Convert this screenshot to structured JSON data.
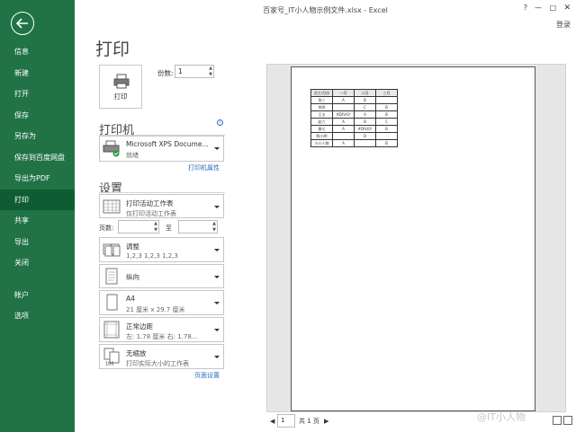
{
  "window": {
    "title": "百家号_IT小人物示例文件.xlsx - Excel",
    "help": "?",
    "min": "—",
    "max": "□",
    "close": "✕",
    "login": "登录"
  },
  "nav": {
    "back_icon": "arrow-left-icon",
    "items": [
      "信息",
      "新建",
      "打开",
      "保存",
      "另存为",
      "保存到百度网盘",
      "导出为PDF",
      "打印",
      "共享",
      "导出",
      "关闭"
    ],
    "items2": [
      "帐户",
      "选项"
    ],
    "active": "打印"
  },
  "page": {
    "title": "打印"
  },
  "print": {
    "button_label": "打印",
    "copies_label": "份数:",
    "copies_value": "1"
  },
  "printer": {
    "header": "打印机",
    "name": "Microsoft XPS Docume...",
    "status": "就绪",
    "properties_link": "打印机属性",
    "info_icon": "i"
  },
  "settings": {
    "header": "设置",
    "scope": {
      "line1": "打印活动工作表",
      "line2": "仅打印活动工作表"
    },
    "pages_label": "页数:",
    "to_label": "至",
    "collate": {
      "line1": "调整",
      "line2": "1,2,3    1,2,3    1,2,3"
    },
    "orientation": {
      "line1": "纵向"
    },
    "paper": {
      "line1": "A4",
      "line2": "21 厘米 x 29.7 厘米"
    },
    "margins": {
      "line1": "正常边距",
      "line2": "左: 1.78 厘米    右: 1.78..."
    },
    "scaling": {
      "line1": "无缩放",
      "line2": "打印实际大小的工作表"
    },
    "page_setup_link": "页面设置"
  },
  "preview": {
    "sheet": [
      [
        "员工/月份",
        "一月",
        "二月",
        "三月"
      ],
      [
        "张三",
        "A",
        "B",
        ""
      ],
      [
        "李四",
        "",
        "C",
        "B"
      ],
      [
        "王五",
        "#DIV/0!",
        "A",
        "B"
      ],
      [
        "赵六",
        "A",
        "B",
        "C"
      ],
      [
        "黄七",
        "A",
        "#DIV/0!",
        "B"
      ],
      [
        "陈小明",
        "",
        "D",
        ""
      ],
      [
        "小小人物",
        "A",
        "",
        "B"
      ]
    ],
    "page_prev": "◀",
    "page_current": "1",
    "page_of": "共 1 页",
    "page_next": "▶",
    "watermark": "@IT小人物"
  }
}
